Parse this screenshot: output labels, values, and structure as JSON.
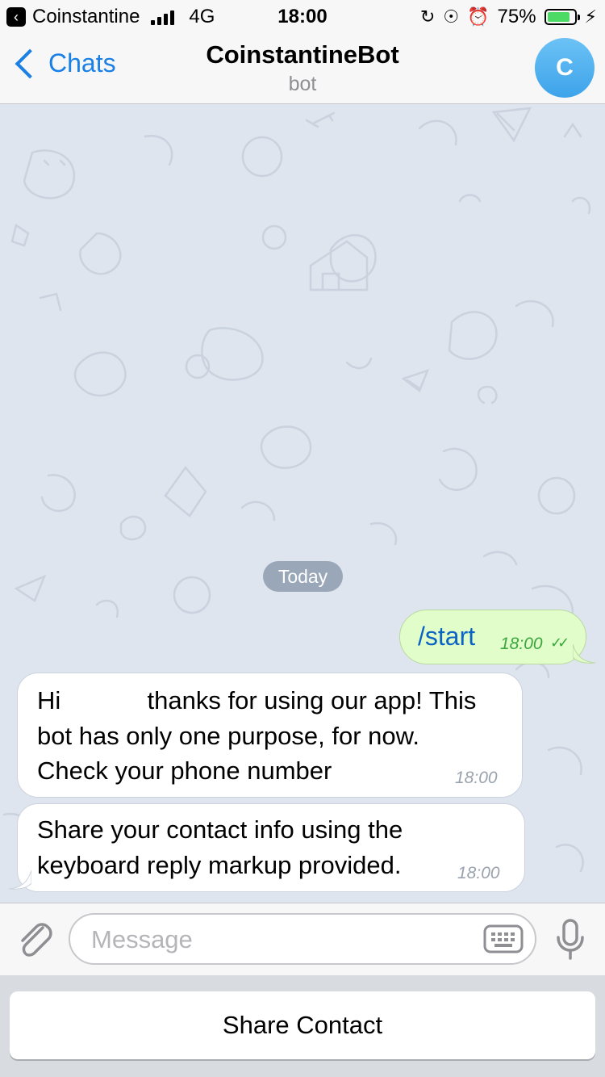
{
  "status_bar": {
    "back_app": "Coinstantine",
    "network": "4G",
    "time": "18:00",
    "battery_percent": "75%"
  },
  "nav": {
    "back_label": "Chats",
    "title": "CoinstantineBot",
    "subtitle": "bot",
    "avatar_letter": "C"
  },
  "chat": {
    "date_separator": "Today",
    "outgoing": {
      "text": "/start",
      "time": "18:00",
      "status": "read"
    },
    "incoming": [
      {
        "lines": [
          "Hi",
          "thanks for using our app! This",
          "bot has only one purpose, for now.",
          "Check your phone number"
        ],
        "time": "18:00"
      },
      {
        "lines": [
          "Share your contact info using the",
          "keyboard reply markup provided."
        ],
        "time": "18:00"
      }
    ]
  },
  "input": {
    "placeholder": "Message",
    "value": ""
  },
  "reply_keyboard": {
    "button_label": "Share Contact"
  },
  "colors": {
    "accent": "#1a80e5",
    "outgoing_bubble": "#e1feca",
    "chat_background": "#dfe5ee",
    "battery": "#4cd964"
  }
}
